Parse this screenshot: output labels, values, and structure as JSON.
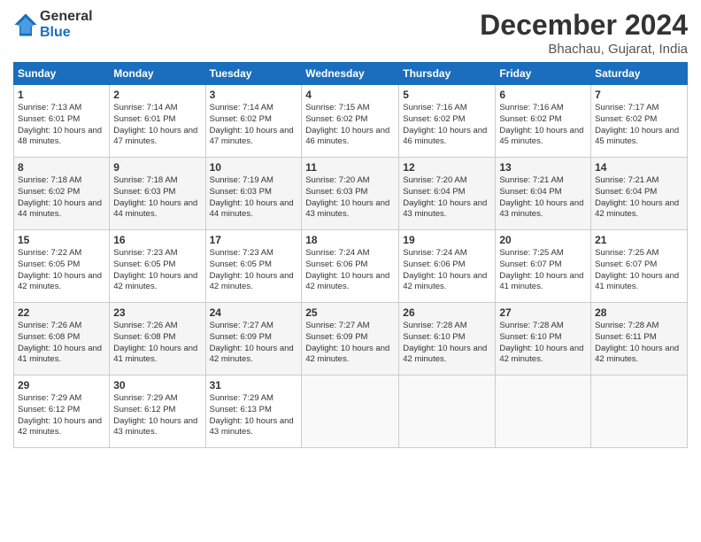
{
  "header": {
    "logo_general": "General",
    "logo_blue": "Blue",
    "month_title": "December 2024",
    "location": "Bhachau, Gujarat, India"
  },
  "calendar": {
    "days_of_week": [
      "Sunday",
      "Monday",
      "Tuesday",
      "Wednesday",
      "Thursday",
      "Friday",
      "Saturday"
    ],
    "weeks": [
      [
        {
          "day": "1",
          "sunrise": "7:13 AM",
          "sunset": "6:01 PM",
          "daylight": "10 hours and 48 minutes."
        },
        {
          "day": "2",
          "sunrise": "7:14 AM",
          "sunset": "6:01 PM",
          "daylight": "10 hours and 47 minutes."
        },
        {
          "day": "3",
          "sunrise": "7:14 AM",
          "sunset": "6:02 PM",
          "daylight": "10 hours and 47 minutes."
        },
        {
          "day": "4",
          "sunrise": "7:15 AM",
          "sunset": "6:02 PM",
          "daylight": "10 hours and 46 minutes."
        },
        {
          "day": "5",
          "sunrise": "7:16 AM",
          "sunset": "6:02 PM",
          "daylight": "10 hours and 46 minutes."
        },
        {
          "day": "6",
          "sunrise": "7:16 AM",
          "sunset": "6:02 PM",
          "daylight": "10 hours and 45 minutes."
        },
        {
          "day": "7",
          "sunrise": "7:17 AM",
          "sunset": "6:02 PM",
          "daylight": "10 hours and 45 minutes."
        }
      ],
      [
        {
          "day": "8",
          "sunrise": "7:18 AM",
          "sunset": "6:02 PM",
          "daylight": "10 hours and 44 minutes."
        },
        {
          "day": "9",
          "sunrise": "7:18 AM",
          "sunset": "6:03 PM",
          "daylight": "10 hours and 44 minutes."
        },
        {
          "day": "10",
          "sunrise": "7:19 AM",
          "sunset": "6:03 PM",
          "daylight": "10 hours and 44 minutes."
        },
        {
          "day": "11",
          "sunrise": "7:20 AM",
          "sunset": "6:03 PM",
          "daylight": "10 hours and 43 minutes."
        },
        {
          "day": "12",
          "sunrise": "7:20 AM",
          "sunset": "6:04 PM",
          "daylight": "10 hours and 43 minutes."
        },
        {
          "day": "13",
          "sunrise": "7:21 AM",
          "sunset": "6:04 PM",
          "daylight": "10 hours and 43 minutes."
        },
        {
          "day": "14",
          "sunrise": "7:21 AM",
          "sunset": "6:04 PM",
          "daylight": "10 hours and 42 minutes."
        }
      ],
      [
        {
          "day": "15",
          "sunrise": "7:22 AM",
          "sunset": "6:05 PM",
          "daylight": "10 hours and 42 minutes."
        },
        {
          "day": "16",
          "sunrise": "7:23 AM",
          "sunset": "6:05 PM",
          "daylight": "10 hours and 42 minutes."
        },
        {
          "day": "17",
          "sunrise": "7:23 AM",
          "sunset": "6:05 PM",
          "daylight": "10 hours and 42 minutes."
        },
        {
          "day": "18",
          "sunrise": "7:24 AM",
          "sunset": "6:06 PM",
          "daylight": "10 hours and 42 minutes."
        },
        {
          "day": "19",
          "sunrise": "7:24 AM",
          "sunset": "6:06 PM",
          "daylight": "10 hours and 42 minutes."
        },
        {
          "day": "20",
          "sunrise": "7:25 AM",
          "sunset": "6:07 PM",
          "daylight": "10 hours and 41 minutes."
        },
        {
          "day": "21",
          "sunrise": "7:25 AM",
          "sunset": "6:07 PM",
          "daylight": "10 hours and 41 minutes."
        }
      ],
      [
        {
          "day": "22",
          "sunrise": "7:26 AM",
          "sunset": "6:08 PM",
          "daylight": "10 hours and 41 minutes."
        },
        {
          "day": "23",
          "sunrise": "7:26 AM",
          "sunset": "6:08 PM",
          "daylight": "10 hours and 41 minutes."
        },
        {
          "day": "24",
          "sunrise": "7:27 AM",
          "sunset": "6:09 PM",
          "daylight": "10 hours and 42 minutes."
        },
        {
          "day": "25",
          "sunrise": "7:27 AM",
          "sunset": "6:09 PM",
          "daylight": "10 hours and 42 minutes."
        },
        {
          "day": "26",
          "sunrise": "7:28 AM",
          "sunset": "6:10 PM",
          "daylight": "10 hours and 42 minutes."
        },
        {
          "day": "27",
          "sunrise": "7:28 AM",
          "sunset": "6:10 PM",
          "daylight": "10 hours and 42 minutes."
        },
        {
          "day": "28",
          "sunrise": "7:28 AM",
          "sunset": "6:11 PM",
          "daylight": "10 hours and 42 minutes."
        }
      ],
      [
        {
          "day": "29",
          "sunrise": "7:29 AM",
          "sunset": "6:12 PM",
          "daylight": "10 hours and 42 minutes."
        },
        {
          "day": "30",
          "sunrise": "7:29 AM",
          "sunset": "6:12 PM",
          "daylight": "10 hours and 43 minutes."
        },
        {
          "day": "31",
          "sunrise": "7:29 AM",
          "sunset": "6:13 PM",
          "daylight": "10 hours and 43 minutes."
        },
        null,
        null,
        null,
        null
      ]
    ]
  }
}
